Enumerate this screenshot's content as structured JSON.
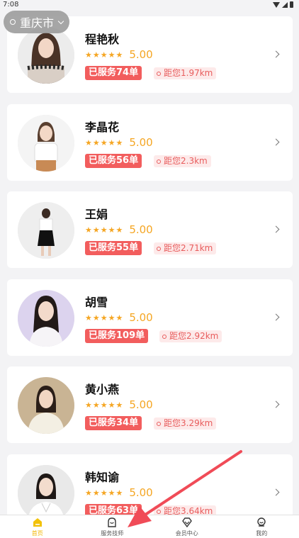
{
  "status_bar": {
    "time": "7:08"
  },
  "location": {
    "city": "重庆市"
  },
  "therapists": [
    {
      "name": "程艳秋",
      "stars": "★★★★★",
      "rating": "5.00",
      "served": "已服务74单",
      "distance": "距您1.97km"
    },
    {
      "name": "李晶花",
      "stars": "★★★★★",
      "rating": "5.00",
      "served": "已服务56单",
      "distance": "距您2.3km"
    },
    {
      "name": "王娟",
      "stars": "★★★★★",
      "rating": "5.00",
      "served": "已服务55单",
      "distance": "距您2.71km"
    },
    {
      "name": "胡雪",
      "stars": "★★★★★",
      "rating": "5.00",
      "served": "已服务109单",
      "distance": "距您2.92km"
    },
    {
      "name": "黄小燕",
      "stars": "★★★★★",
      "rating": "5.00",
      "served": "已服务34单",
      "distance": "距您3.29km"
    },
    {
      "name": "韩知谕",
      "stars": "★★★★★",
      "rating": "5.00",
      "served": "已服务63单",
      "distance": "距您3.64km"
    }
  ],
  "tabs": [
    {
      "label": "首页",
      "icon": "home-icon",
      "active": true
    },
    {
      "label": "服务技师",
      "icon": "technician-icon",
      "active": false
    },
    {
      "label": "会员中心",
      "icon": "diamond-icon",
      "active": false
    },
    {
      "label": "我的",
      "icon": "profile-icon",
      "active": false
    }
  ],
  "colors": {
    "accent": "#f2b705",
    "star": "#f5a623",
    "badge": "#f25d5d",
    "annotation": "#f04b57"
  }
}
